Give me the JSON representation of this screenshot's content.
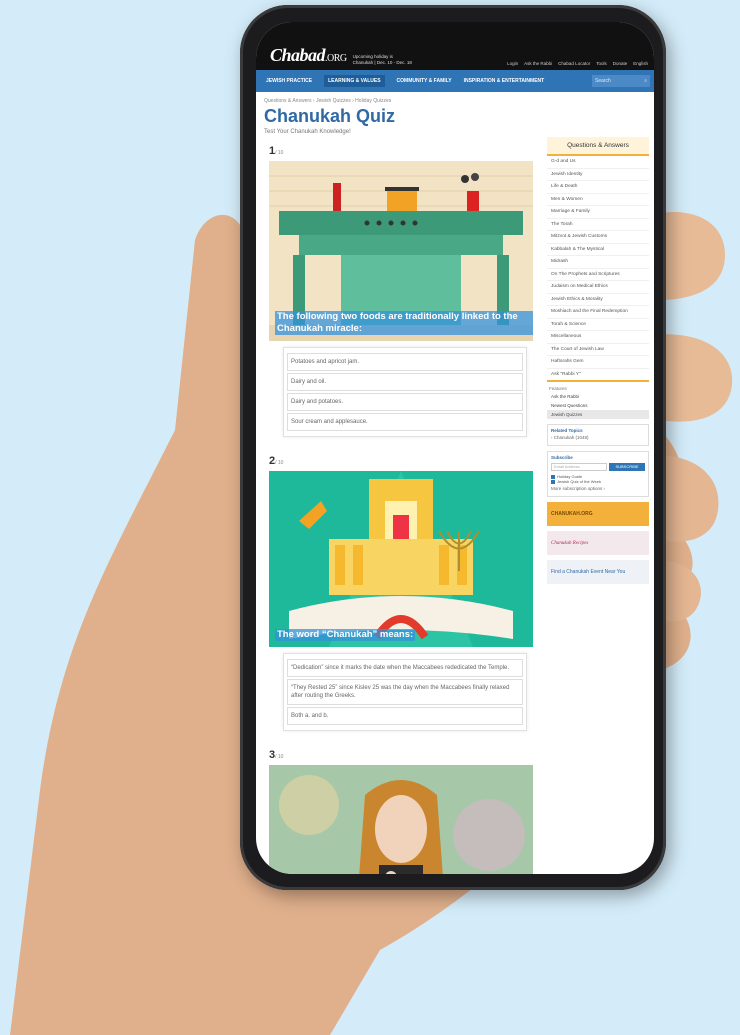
{
  "topbar": {
    "logo": "Chabad",
    "logo_suffix": ".ORG",
    "holiday_line1": "Upcoming holiday is",
    "holiday_line2": "Chanukah | Dec. 10 - Dec. 18",
    "links": [
      "Login",
      "Ask the Rabbi",
      "Chabad Locator",
      "Tools",
      "Donate",
      "English"
    ]
  },
  "nav": {
    "items": [
      "JEWISH PRACTICE",
      "LEARNING & VALUES",
      "COMMUNITY & FAMILY",
      "INSPIRATION & ENTERTAINMENT"
    ],
    "search_placeholder": "Search"
  },
  "breadcrumb": [
    "Questions & Answers",
    "Jewish Quizzes",
    "Holiday Quizzes"
  ],
  "title": "Chanukah Quiz",
  "subtitle": "Test Your Chanukah Knowledge!",
  "questions": [
    {
      "num": "1",
      "total": "/ 10",
      "text": "The following two foods are traditionally linked to the Chanukah miracle:",
      "answers": [
        "Potatoes and apricot jam.",
        "Dairy and oil.",
        "Dairy and potatoes.",
        "Sour cream and applesauce."
      ]
    },
    {
      "num": "2",
      "total": "/ 10",
      "text": "The word “Chanukah” means:",
      "answers": [
        "“Dedication” since it marks the date when the Maccabees rededicated the Temple.",
        "“They Rested 25” since Kislev 25 was the day when the Maccabees finally relaxed after routing the Greeks.",
        "Both a. and b."
      ]
    },
    {
      "num": "3",
      "total": "/ 10"
    }
  ],
  "sidebar": {
    "heading": "Questions & Answers",
    "items": [
      "G-d and Us",
      "Jewish Identity",
      "Life & Death",
      "Men & Women",
      "Marriage & Family",
      "The Torah",
      "Mitzvot & Jewish Customs",
      "Kabbalah & The Mystical",
      "Midrash",
      "On The Prophets and Scriptures",
      "Judaism on Medical Ethics",
      "Jewish Ethics & Morality",
      "Moshiach and the Final Redemption",
      "Torah & Science",
      "Miscellaneous",
      "The Court of Jewish Law",
      "Haftorahs Gem",
      "Ask \"Rabbi Y\""
    ],
    "features_label": "Features",
    "features": [
      "Ask the Rabbi",
      "Newest Questions",
      "Jewish Quizzes"
    ],
    "related_title": "Related Topics",
    "related_item": "› Chanukah (1048)",
    "subscribe_title": "Subscribe",
    "email_placeholder": "Email Address",
    "subscribe_button": "SUBSCRIBE",
    "checks": [
      "Holiday Guide",
      "Jewish Quiz of the Week"
    ],
    "more_options": "More subscription options ›",
    "banners": [
      "CHANUKAH.ORG",
      "Chanukah Recipes",
      "Find a Chanukah Event Near You"
    ]
  },
  "colors": {
    "nav_blue": "#2f74b5",
    "title_blue": "#2f6aa5",
    "accent_orange": "#f3b03a",
    "background": "#d4ecf9"
  }
}
